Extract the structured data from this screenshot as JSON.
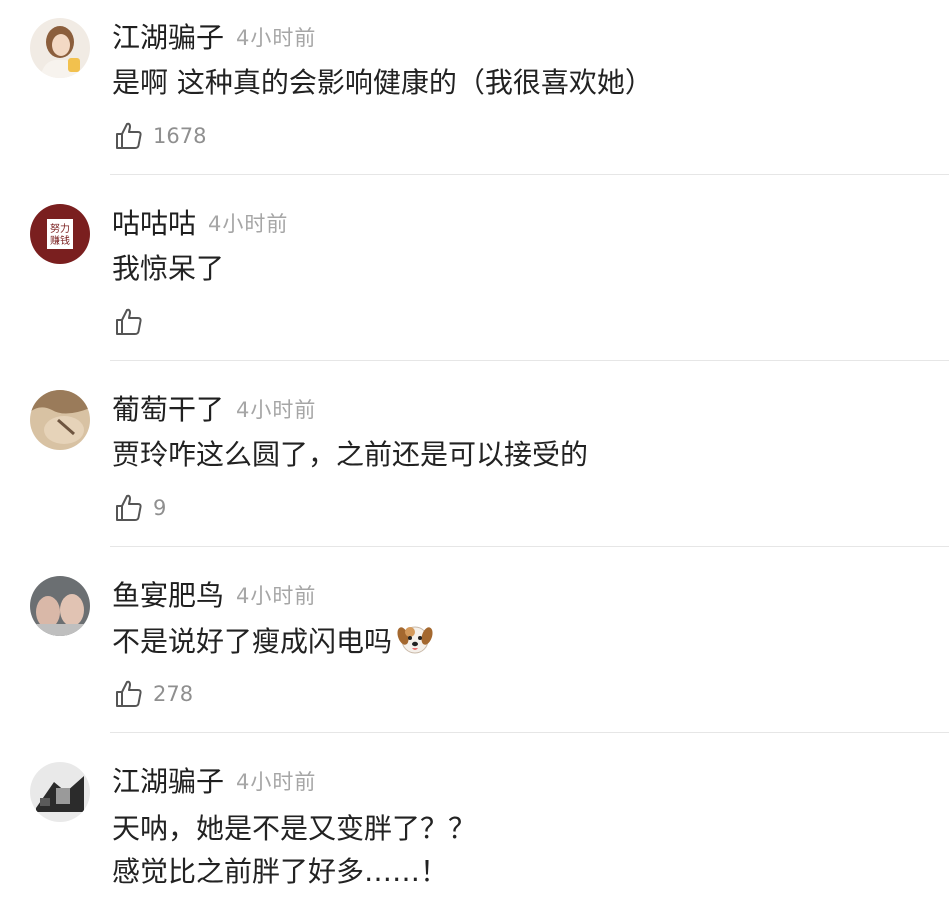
{
  "comments": [
    {
      "username": "江湖骗子",
      "time": "4小时前",
      "lines": [
        "是啊 这种真的会影响健康的（我很喜欢她）"
      ],
      "likes": "1678",
      "avatar_icon": "woman-avatar"
    },
    {
      "username": "咕咕咕",
      "time": "4小时前",
      "lines": [
        "我惊呆了"
      ],
      "likes": "",
      "avatar_icon": "badge-avatar",
      "avatar_text": [
        "努力",
        "赚钱"
      ]
    },
    {
      "username": "葡萄干了",
      "time": "4小时前",
      "lines": [
        "贾玲咋这么圆了，之前还是可以接受的"
      ],
      "likes": "9",
      "avatar_icon": "photo-avatar"
    },
    {
      "username": "鱼宴肥鸟",
      "time": "4小时前",
      "lines": [
        "不是说好了瘦成闪电吗"
      ],
      "emoji": "dog-face-emoji",
      "likes": "278",
      "avatar_icon": "photo-avatar"
    },
    {
      "username": "江湖骗子",
      "time": "4小时前",
      "lines": [
        "天呐，她是不是又变胖了？？",
        "感觉比之前胖了好多……！"
      ],
      "likes": "",
      "avatar_icon": "photo-avatar"
    }
  ],
  "colors": {
    "username": "#1f1f1f",
    "time": "#a6a6a6",
    "like_count": "#8f8f8f",
    "divider": "#e6e6e6",
    "badge_bg": "#7a1f1f"
  }
}
